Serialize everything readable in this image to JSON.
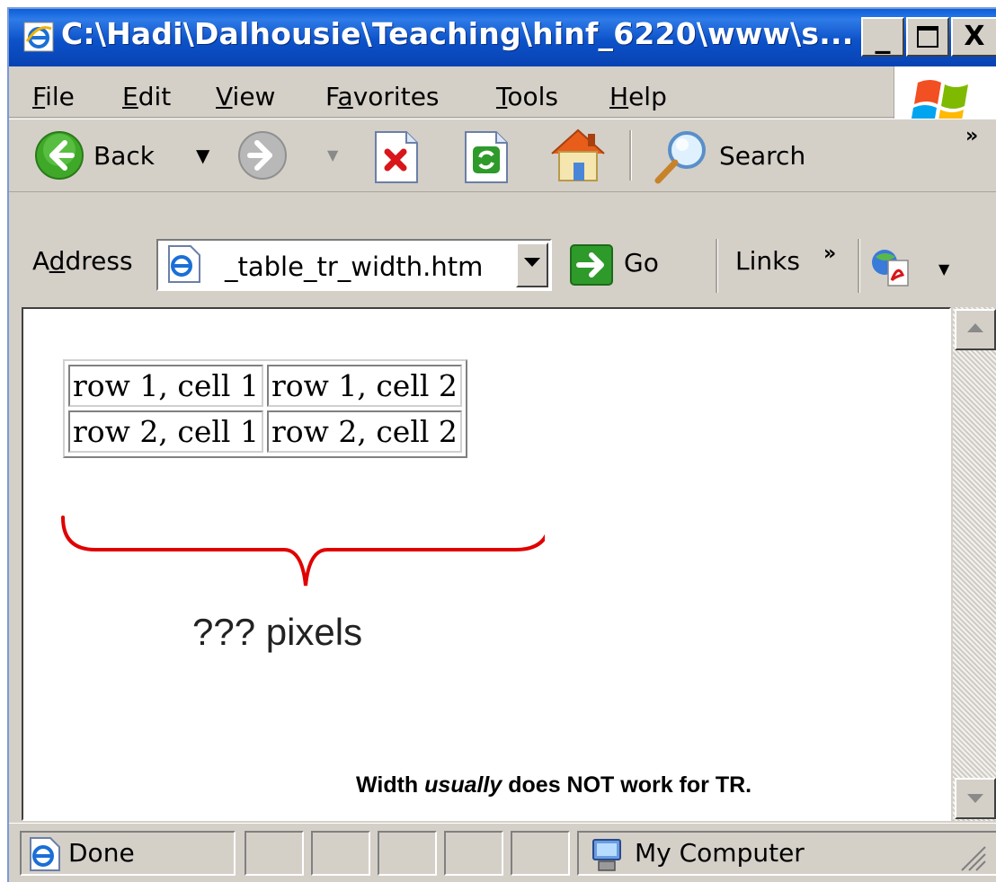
{
  "window": {
    "title": "C:\\Hadi\\Dalhousie\\Teaching\\hinf_6220\\www\\s...",
    "minimize_glyph": "_",
    "maximize_glyph": "□",
    "close_glyph": "X"
  },
  "menu": {
    "items": [
      {
        "prefix": "",
        "accel": "F",
        "rest": "ile"
      },
      {
        "prefix": "",
        "accel": "E",
        "rest": "dit"
      },
      {
        "prefix": "",
        "accel": "V",
        "rest": "iew"
      },
      {
        "prefix": "F",
        "accel": "a",
        "rest": "vorites"
      },
      {
        "prefix": "",
        "accel": "T",
        "rest": "ools"
      },
      {
        "prefix": "",
        "accel": "H",
        "rest": "elp"
      }
    ]
  },
  "toolbar": {
    "back_label": "Back",
    "search_label": "Search",
    "chevron": "»"
  },
  "address": {
    "label_prefix": "A",
    "label_accel": "d",
    "label_rest": "dress",
    "value": "_table_tr_width.htm",
    "go_label": "Go",
    "links_label": "Links",
    "links_chevron": "»"
  },
  "content": {
    "table": [
      [
        "row 1, cell 1",
        "row 1, cell 2"
      ],
      [
        "row 2, cell 1",
        "row 2, cell 2"
      ]
    ],
    "brace_label": "??? pixels",
    "note_before": "Width ",
    "note_emph": "usually",
    "note_after": " does NOT work for TR."
  },
  "status": {
    "text": "Done",
    "zone": "My Computer"
  },
  "colors": {
    "title_bar": "#0a5fd8",
    "chrome": "#d4d0c8",
    "brace": "#e00000"
  }
}
